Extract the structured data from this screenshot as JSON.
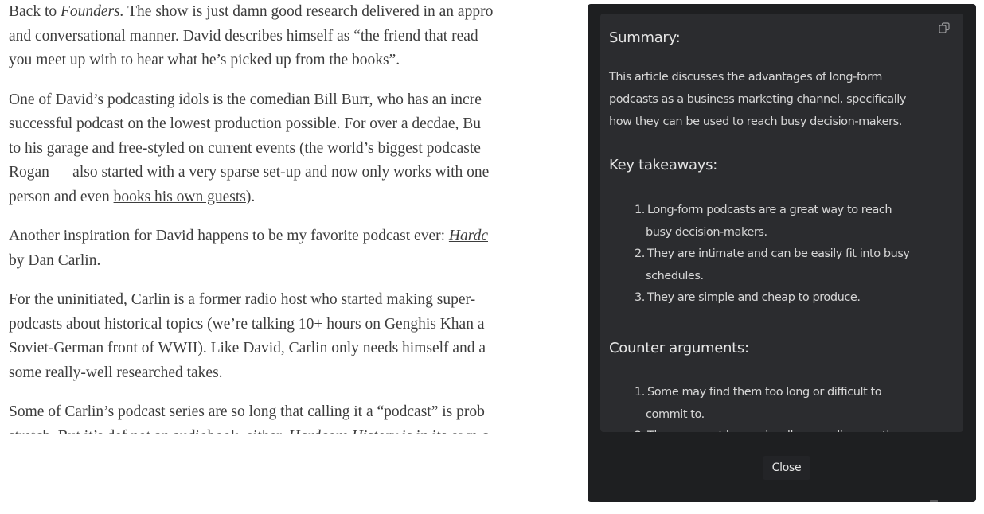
{
  "article": {
    "p1": {
      "l1_a": "Back to ",
      "l1_em": "Founders.",
      "l1_b": " The show is just damn good research delivered in an appro",
      "l2": "and conversational manner. David describes himself as “the friend that read",
      "l3": "you meet up with to hear what he’s picked up from the books”."
    },
    "p2": {
      "l1": "One of David’s podcasting idols is the comedian Bill Burr, who has an incre",
      "l2": "successful podcast on the lowest production possible. For over a decdae, Bu",
      "l3": "to his garage and free-styled on current events (the world’s biggest podcaste",
      "l4": "Rogan — also started with a very sparse set-up and now only works with one",
      "l5_a": "person and even ",
      "l5_link": "books his own guests",
      "l5_b": ")."
    },
    "p3": {
      "l1_a": "Another inspiration for David happens to be my favorite podcast ever: ",
      "l1_link": "Hardc",
      "l2": "by Dan Carlin."
    },
    "p4": {
      "l1": "For the uninitiated, Carlin is a former radio host who started making super-",
      "l2": "podcasts about historical topics (we’re talking 10+ hours on Genghis Khan a",
      "l3": "Soviet-German front of WWII). Like David, Carlin only needs himself and a",
      "l4": "some really-well researched takes."
    },
    "p5": {
      "l1": "Some of Carlin’s podcast series are so long that calling it a “podcast” is prob",
      "l2_a": "stretch. But it’s def not an audiobook, either. ",
      "l2_em": "Hardcore History",
      "l2_b": " is in its own c"
    }
  },
  "summary_panel": {
    "copy_icon": "copy-icon",
    "summary_heading": "Summary:",
    "summary_lines": [
      "This article discusses the advantages of long-form",
      "podcasts as a business marketing channel, specifically",
      "how they can be used to reach busy decision-makers."
    ],
    "takeaways_heading": "Key takeaways:",
    "takeaways": [
      {
        "num": "1.",
        "l1": "Long-form podcasts are a great way to reach",
        "l2": "busy decision-makers."
      },
      {
        "num": "2.",
        "l1": "They are intimate and can be easily fit into busy",
        "l2": "schedules."
      },
      {
        "num": "3.",
        "l1": "They are simple and cheap to produce.",
        "l2": ""
      }
    ],
    "counter_heading": "Counter arguments:",
    "counters": [
      {
        "num": "1.",
        "l1": "Some may find them too long or difficult to",
        "l2": "commit to."
      },
      {
        "num": "2.",
        "l1": "They may not be as visually appealing as other",
        "l2": ""
      }
    ],
    "close_label": "Close"
  }
}
